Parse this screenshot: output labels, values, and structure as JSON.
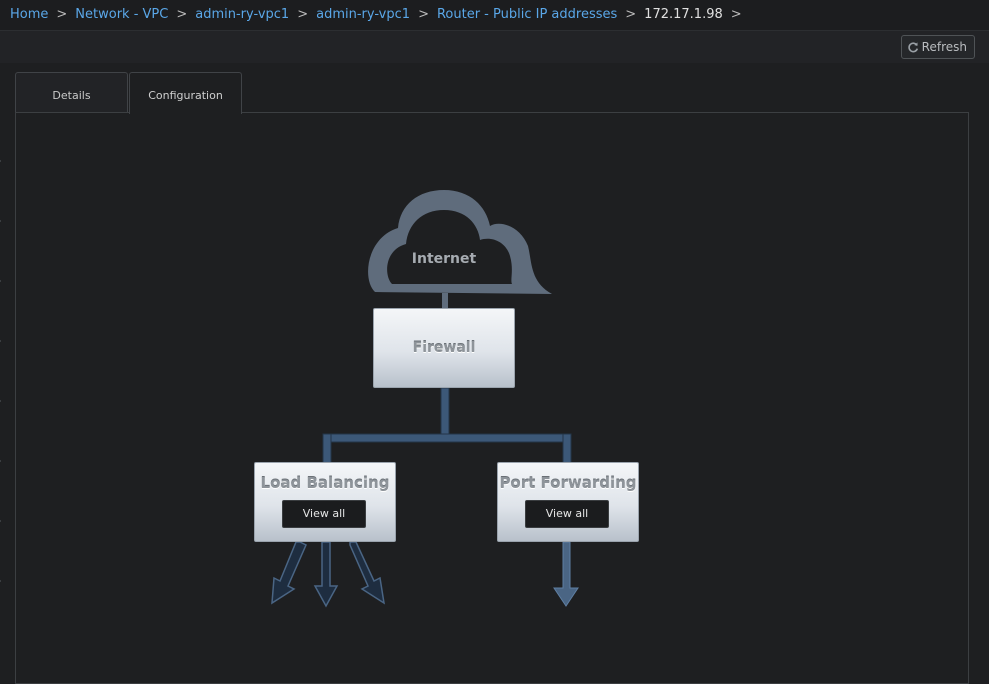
{
  "breadcrumb": {
    "items": [
      "Home",
      "Network - VPC",
      "admin-ry-vpc1",
      "admin-ry-vpc1",
      "Router - Public IP addresses"
    ],
    "current": "172.17.1.98",
    "separator": ">"
  },
  "toolbar": {
    "refresh_label": "Refresh"
  },
  "tabs": [
    {
      "label": "Details"
    },
    {
      "label": "Configuration"
    }
  ],
  "diagram": {
    "internet_label": "Internet",
    "firewall_label": "Firewall",
    "load_balancing": {
      "title": "Load Balancing",
      "button": "View all"
    },
    "port_forwarding": {
      "title": "Port Forwarding",
      "button": "View all"
    }
  },
  "colors": {
    "link": "#5aa7e8",
    "cloud": "#5f6c7c",
    "connector": "#4a6584",
    "connector_fill": "#1e2d40"
  }
}
